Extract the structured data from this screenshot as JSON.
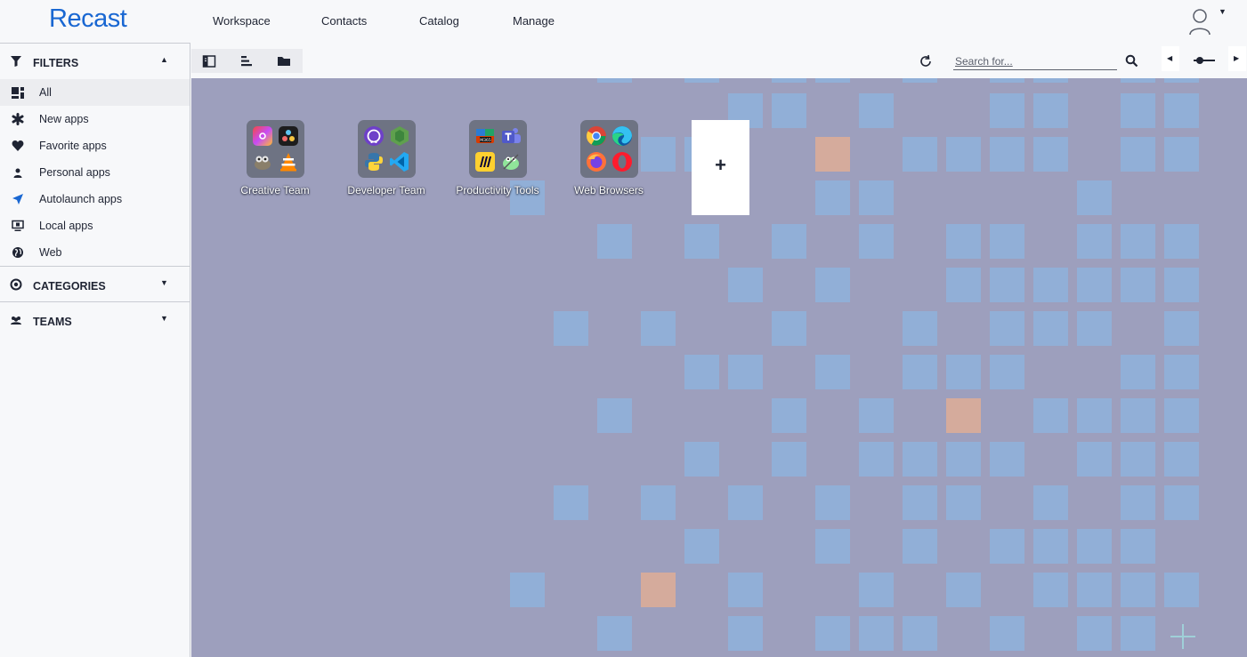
{
  "app": {
    "logo": "Recast",
    "brand_color": "#1967d2"
  },
  "nav": {
    "items": [
      "Workspace",
      "Contacts",
      "Catalog",
      "Manage"
    ]
  },
  "sidebar": {
    "filters": {
      "title": "FILTERS",
      "items": [
        {
          "label": "All",
          "icon": "all-apps-icon",
          "active": true
        },
        {
          "label": "New apps",
          "icon": "sparkle-icon"
        },
        {
          "label": "Favorite apps",
          "icon": "heart-icon"
        },
        {
          "label": "Personal apps",
          "icon": "person-icon"
        },
        {
          "label": "Autolaunch apps",
          "icon": "rocket-icon"
        },
        {
          "label": "Local apps",
          "icon": "monitor-icon"
        },
        {
          "label": "Web",
          "icon": "globe-icon"
        }
      ]
    },
    "categories": {
      "title": "CATEGORIES"
    },
    "teams": {
      "title": "TEAMS"
    }
  },
  "toolbar": {
    "search_placeholder": "Search for..."
  },
  "workspace": {
    "background_color": "#9d9fbd",
    "groups": [
      {
        "name": "Creative Team",
        "apps": [
          "creative-cloud-icon",
          "davinci-resolve-icon",
          "gimp-icon",
          "vlc-icon"
        ]
      },
      {
        "name": "Developer Team",
        "apps": [
          "github-icon",
          "nodejs-icon",
          "python-icon",
          "vscode-icon"
        ]
      },
      {
        "name": "Productivity Tools",
        "apps": [
          "office-icon",
          "teams-icon",
          "miro-icon",
          "notepad-plus-plus-icon"
        ]
      },
      {
        "name": "Web Browsers",
        "apps": [
          "chrome-icon",
          "edge-icon",
          "firefox-icon",
          "opera-icon"
        ]
      }
    ],
    "add_label": "+"
  }
}
